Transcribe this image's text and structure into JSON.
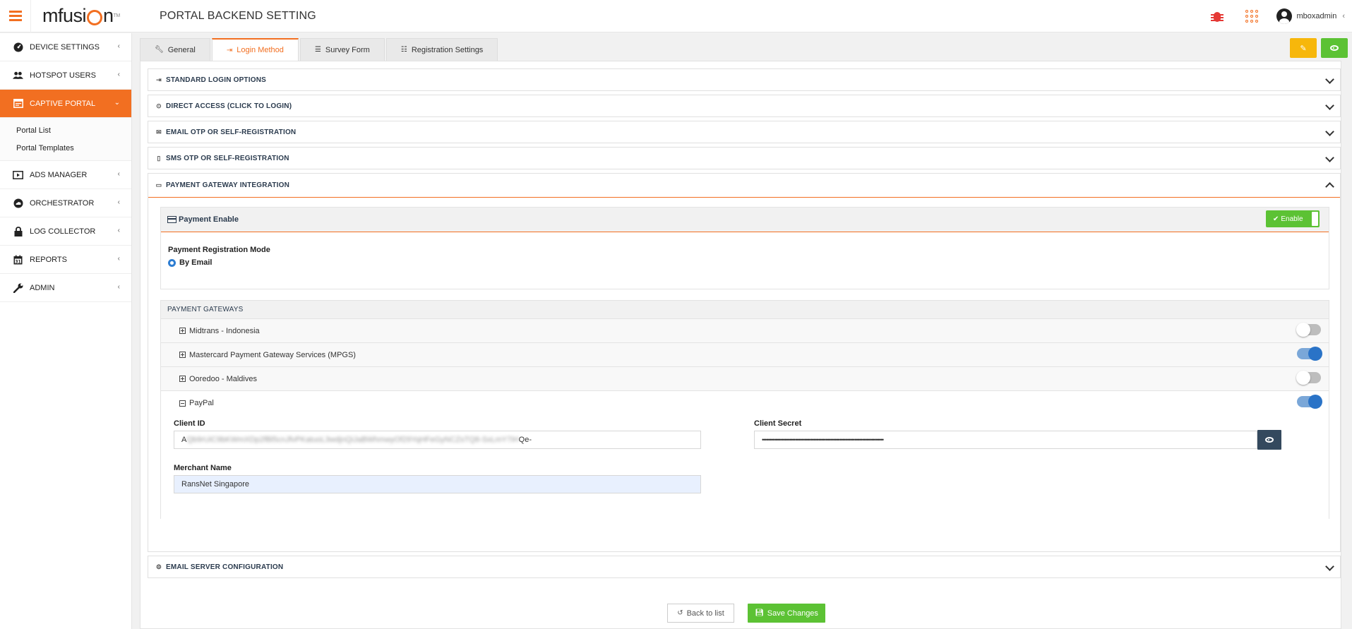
{
  "header": {
    "logo_text": "mfusi",
    "logo_tail": "n",
    "logo_tm": "TM",
    "title": "PORTAL BACKEND SETTING",
    "username": "mboxadmin"
  },
  "sidebar": {
    "items": [
      {
        "label": "DEVICE SETTINGS"
      },
      {
        "label": "HOTSPOT USERS"
      },
      {
        "label": "CAPTIVE PORTAL"
      },
      {
        "label": "ADS MANAGER"
      },
      {
        "label": "ORCHESTRATOR"
      },
      {
        "label": "LOG COLLECTOR"
      },
      {
        "label": "REPORTS"
      },
      {
        "label": "ADMIN"
      }
    ],
    "subitems": [
      {
        "label": "Portal List"
      },
      {
        "label": "Portal Templates"
      }
    ]
  },
  "tabs": [
    {
      "label": "General"
    },
    {
      "label": "Login Method"
    },
    {
      "label": "Survey Form"
    },
    {
      "label": "Registration Settings"
    }
  ],
  "sections": {
    "standard": "STANDARD LOGIN OPTIONS",
    "direct": "DIRECT ACCESS (CLICK TO LOGIN)",
    "email_otp": "EMAIL OTP OR SELF-REGISTRATION",
    "sms_otp": "SMS OTP OR SELF-REGISTRATION",
    "payment": "PAYMENT GATEWAY INTEGRATION",
    "email_server": "EMAIL SERVER CONFIGURATION"
  },
  "payment": {
    "enable_title": "Payment Enable",
    "enable_label": "Enable",
    "mode_label": "Payment Registration Mode",
    "mode_option": "By Email",
    "gateways_title": "PAYMENT GATEWAYS",
    "gateways": [
      {
        "name": "Midtrans - Indonesia",
        "enabled": false
      },
      {
        "name": "Mastercard Payment Gateway Services (MPGS)",
        "enabled": true
      },
      {
        "name": "Ooredoo - Maldives",
        "enabled": false
      },
      {
        "name": "PayPal",
        "enabled": true
      }
    ],
    "paypal": {
      "client_id_label": "Client ID",
      "client_id_start": "A",
      "client_id_hidden": "Qb9rUiC9bKWmXDp2fBl5cnJfvPKatuoL3wdjnQiJaBWhmwyOf29YqHFeGyNCZsTQ8-SxLmY7iH",
      "client_id_end": "Qe-",
      "client_secret_label": "Client Secret",
      "client_secret_value": "••••••••••••••••••••••••••••••••••••••••••••••••••••••••••••••••••••••••••••••••",
      "merchant_label": "Merchant Name",
      "merchant_value": "RansNet Singapore"
    }
  },
  "buttons": {
    "back": "Back to list",
    "save": "Save Changes"
  },
  "colors": {
    "accent": "#f26f21",
    "success": "#5cc234",
    "warning": "#f7b70b",
    "toggle_on": "#2a73c7"
  }
}
